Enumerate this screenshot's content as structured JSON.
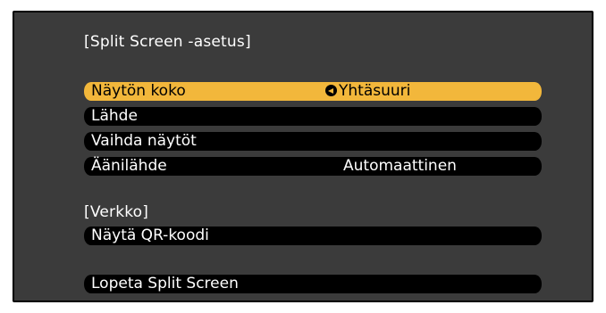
{
  "osd": {
    "title": "[Split Screen -asetus]",
    "items": [
      {
        "label": "Näytön koko",
        "value": "Yhtäsuuri",
        "selected": true
      },
      {
        "label": "Lähde",
        "value": ""
      },
      {
        "label": "Vaihda näytöt",
        "value": ""
      },
      {
        "label": "Äänilähde",
        "value": "Automaattinen"
      }
    ],
    "network_heading": "[Verkko]",
    "network_item": "Näytä QR-koodi",
    "exit_item": "Lopeta Split Screen",
    "colors": {
      "background": "#3b3b3b",
      "item_background": "#000000",
      "highlight": "#f2b73b"
    },
    "icons": {
      "selected_value_marker": "enter-arrow-icon"
    }
  }
}
